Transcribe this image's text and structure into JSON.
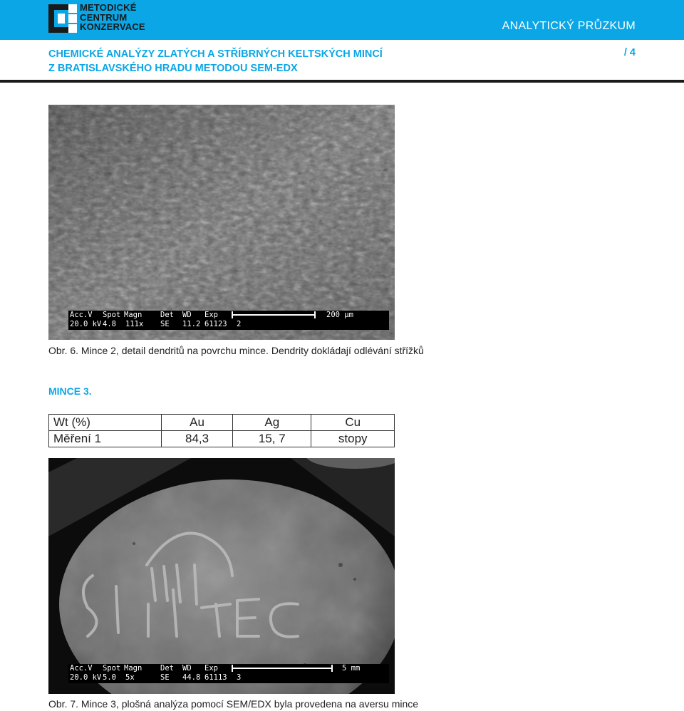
{
  "header": {
    "logo_lines": [
      "METODICKÉ",
      "CENTRUM",
      "KONZERVACE"
    ],
    "section_label": "ANALYTICKÝ PRŮZKUM",
    "accent_color": "#0aa6e6"
  },
  "document": {
    "title_line1": "CHEMICKÉ ANALÝZY ZLATÝCH A STŘÍBRNÝCH KELTSKÝCH MINCÍ",
    "title_line2": "Z BRATISLAVSKÉHO HRADU METODOU SEM-EDX",
    "page_number": "/ 4"
  },
  "figure1": {
    "databar_headers": [
      "Acc.V",
      "Spot",
      "Magn",
      "Det",
      "WD",
      "Exp"
    ],
    "databar_values": [
      "20.0 kV",
      "4.8",
      "111x",
      "SE",
      "11.2",
      "61123",
      "2"
    ],
    "scale_label": "200 µm",
    "caption": "Obr. 6. Mince 2, detail dendritů na povrchu mince. Dendrity dokládají odlévání střížků"
  },
  "section": {
    "heading": "MINCE 3."
  },
  "results_table": {
    "headers": [
      "Wt (%)",
      "Au",
      "Ag",
      "Cu"
    ],
    "rows": [
      [
        "Měření 1",
        "84,3",
        "15, 7",
        "stopy"
      ]
    ]
  },
  "figure2": {
    "databar_headers": [
      "Acc.V",
      "Spot",
      "Magn",
      "Det",
      "WD",
      "Exp"
    ],
    "databar_values": [
      "20.0 kV",
      "5.0",
      "5x",
      "SE",
      "44.8",
      "61113",
      "3"
    ],
    "scale_label": "5 mm",
    "caption": "Obr. 7. Mince 3, plošná analýza pomocí SEM/EDX byla provedena na aversu mince"
  }
}
